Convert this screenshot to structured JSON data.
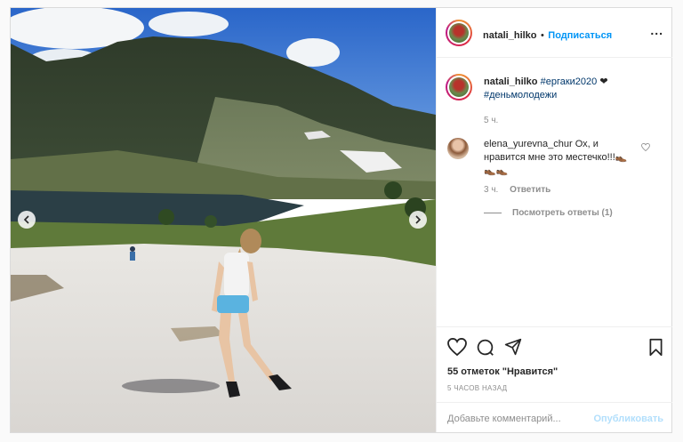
{
  "post": {
    "author": "natali_hilko",
    "separator": "•",
    "follow_label": "Подписаться",
    "more_label": "...",
    "caption": {
      "author": "natali_hilko",
      "tag1": "#ергаки2020",
      "heart": "❤",
      "tag2": "#деньмолодежи",
      "time": "5 ч."
    },
    "comment": {
      "author": "elena_yurevna_chur",
      "text": "Ох, и нравится мне это местечко!!!👞👞👞",
      "time": "3 ч.",
      "reply_label": "Ответить",
      "view_replies": "Посмотреть ответы (1)"
    },
    "likes": "55 отметок \"Нравится\"",
    "posted_ago": "5 ЧАСОВ НАЗАД",
    "add_comment_placeholder": "Добавьте комментарий...",
    "publish_label": "Опубликовать"
  },
  "icons": [
    "chevron-left-icon",
    "chevron-right-icon",
    "heart-icon",
    "comment-icon",
    "share-icon",
    "bookmark-icon",
    "more-icon",
    "like-comment-icon"
  ],
  "colors": {
    "link": "#0095f6",
    "hashtag": "#00376b",
    "muted": "#8e8e8e",
    "publish_disabled": "#b2dffc"
  }
}
